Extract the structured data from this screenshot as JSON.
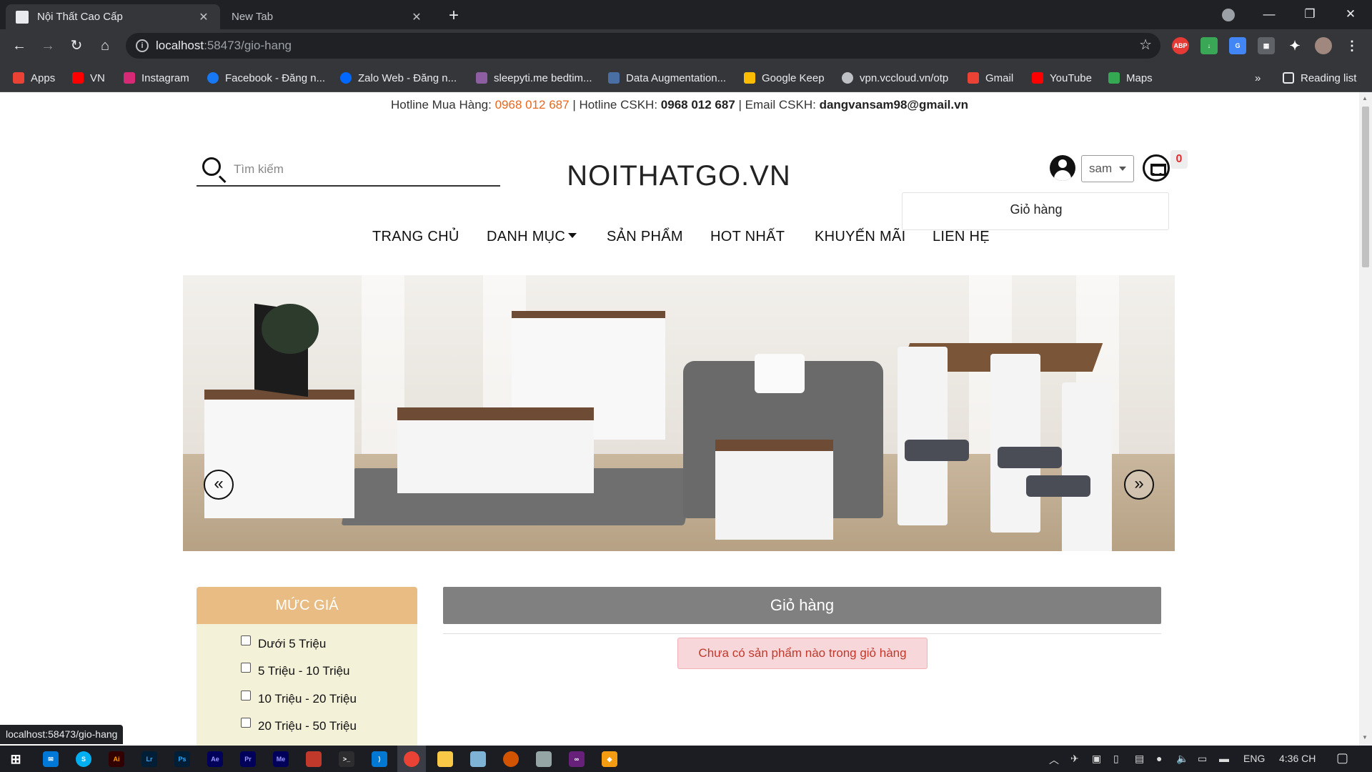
{
  "browser": {
    "tabs": [
      {
        "title": "Nội Thất Cao Cấp",
        "active": true
      },
      {
        "title": "New Tab",
        "active": false
      }
    ],
    "url_host": "localhost",
    "url_rest": ":58473/gio-hang",
    "bookmarks": [
      {
        "label": "Apps",
        "icon": "apps-grid-icon",
        "color": "#ea4335"
      },
      {
        "label": "VN",
        "icon": "youtube-icon",
        "color": "#ff0000"
      },
      {
        "label": "Instagram",
        "icon": "instagram-icon",
        "color": "#d62976"
      },
      {
        "label": "Facebook - Đăng n...",
        "icon": "facebook-icon",
        "color": "#1877f2"
      },
      {
        "label": "Zalo Web - Đăng n...",
        "icon": "zalo-icon",
        "color": "#0068ff"
      },
      {
        "label": "sleepyti.me bedtim...",
        "icon": "sleepytime-icon",
        "color": "#8e5ea2"
      },
      {
        "label": "Data Augmentation...",
        "icon": "page-icon",
        "color": "#4a6fa5"
      },
      {
        "label": "Google Keep",
        "icon": "google-keep-icon",
        "color": "#fbbc04"
      },
      {
        "label": "vpn.vccloud.vn/otp",
        "icon": "globe-icon",
        "color": "#bdc1c6"
      },
      {
        "label": "Gmail",
        "icon": "gmail-icon",
        "color": "#ea4335"
      },
      {
        "label": "YouTube",
        "icon": "youtube-icon",
        "color": "#ff0000"
      },
      {
        "label": "Maps",
        "icon": "google-maps-icon",
        "color": "#34a853"
      }
    ],
    "reading_list": "Reading list",
    "status_url": "localhost:58473/gio-hang"
  },
  "page": {
    "hotline_buy_label": "Hotline Mua Hàng:",
    "hotline_buy": "0968 012 687",
    "hotline_care_label": "| Hotline CSKH:",
    "hotline_care": "0968 012 687",
    "email_label": "| Email CSKH:",
    "email": "dangvansam98@gmail.vn",
    "search_placeholder": "Tìm kiếm",
    "logo": "NOITHATGO.VN",
    "user_name": "sam",
    "cart_count": "0",
    "dropdown_item": "Giỏ hàng",
    "nav": [
      "TRANG CHỦ",
      "DANH MỤC",
      "SẢN PHẨM",
      "HOT NHẤT",
      "KHUYẾN MÃI",
      "LIÊN HỆ"
    ],
    "carousel_prev": "«",
    "carousel_next": "»"
  },
  "sidebar": {
    "title": "MỨC GIÁ",
    "options": [
      "Dưới 5 Triệu",
      "5 Triệu - 10 Triệu",
      "10 Triệu - 20 Triệu",
      "20 Triệu - 50 Triệu"
    ]
  },
  "cart": {
    "title": "Giỏ hàng",
    "empty_message": "Chưa có sản phẩm nào trong giỏ hàng"
  },
  "taskbar": {
    "lang": "ENG",
    "time": "4:36 CH"
  },
  "colors": {
    "accent_orange": "#e8671c",
    "price_header": "#e8bc82",
    "price_body": "#f4f1d9",
    "cart_header": "#808080",
    "alert_bg": "#f8d7da",
    "alert_text": "#c0392b"
  }
}
